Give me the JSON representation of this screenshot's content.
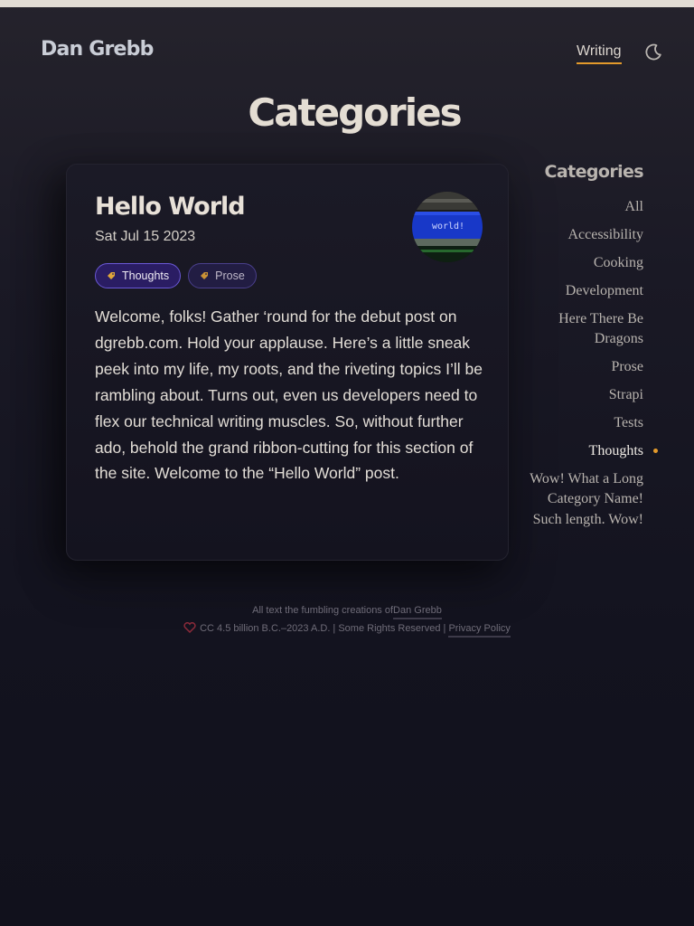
{
  "header": {
    "brand": "Dan Grebb",
    "nav_writing": "Writing",
    "theme_icon": "moon-icon"
  },
  "page": {
    "title": "Categories"
  },
  "post": {
    "title": "Hello World",
    "date": "Sat Jul 15 2023",
    "thumbnail_text": "world!",
    "tags": [
      {
        "label": "Thoughts",
        "icon": "tag-icon"
      },
      {
        "label": "Prose",
        "icon": "tag-icon"
      }
    ],
    "excerpt": "Welcome, folks! Gather ‘round for the debut post on dgrebb.com. Hold your applause. Here’s a little sneak peek into my life, my roots, and the riveting topics I’ll be rambling about. Turns out, even us developers need to flex our technical writing muscles. So, without further ado, behold the grand ribbon-cutting for this section of the site. Welcome to the “Hello World” post."
  },
  "sidebar": {
    "heading": "Categories",
    "items": [
      {
        "label": "All"
      },
      {
        "label": "Accessibility"
      },
      {
        "label": "Cooking"
      },
      {
        "label": "Development"
      },
      {
        "label": "Here There Be Dragons"
      },
      {
        "label": "Prose"
      },
      {
        "label": "Strapi"
      },
      {
        "label": "Tests"
      },
      {
        "label": "Thoughts"
      },
      {
        "label": "Wow! What a Long Category Name! Such length. Wow!"
      }
    ],
    "active_index": 8
  },
  "footer": {
    "line1_text": "All text the fumbling creations of",
    "author_link": "Dan Grebb",
    "license_text": "CC 4.5 billion B.C.–2023 A.D. | Some Rights Reserved |",
    "privacy_link": "Privacy Policy"
  },
  "colors": {
    "accent": "#e39a2b",
    "tag_active_bg": "#2a1d63",
    "tag_border": "#6a58d6",
    "background": "#13131f"
  }
}
